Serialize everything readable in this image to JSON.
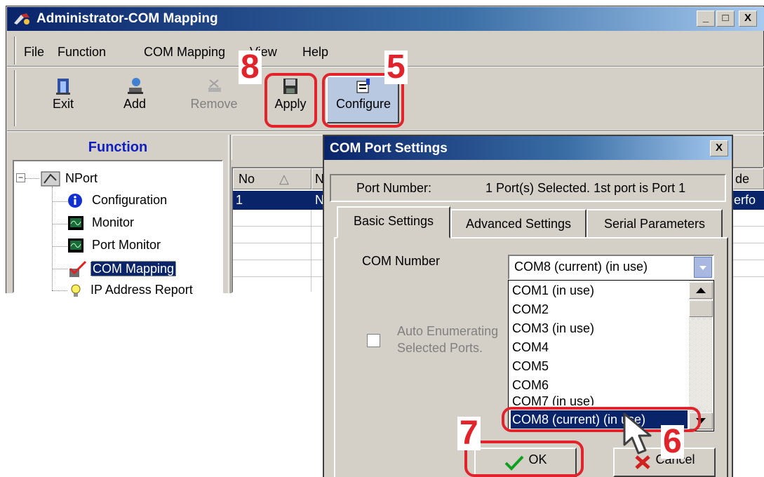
{
  "window": {
    "title": "Administrator-COM Mapping",
    "minimize": "_",
    "maximize": "□",
    "close": "X"
  },
  "menu": [
    "File",
    "Function",
    "COM Mapping",
    "View",
    "Help"
  ],
  "toolbar": {
    "exit": "Exit",
    "add": "Add",
    "remove": "Remove",
    "apply": "Apply",
    "configure": "Configure"
  },
  "function_header": "Function",
  "tree": {
    "root": "NPort",
    "expander": "−",
    "items": [
      "Configuration",
      "Monitor",
      "Port Monitor",
      "COM Mapping",
      "IP Address Report"
    ]
  },
  "table": {
    "col_no": "No",
    "sort_glyph": "△",
    "col_trunc": "N",
    "col_mode_trunc": "de",
    "row_no": "1",
    "row_trunc": "N",
    "row_mode_trunc": "erfo"
  },
  "dialog": {
    "title": "COM Port Settings",
    "close": "X",
    "port_number_label": "Port Number:",
    "port_number_value": "1 Port(s) Selected. 1st port is Port 1",
    "tabs": [
      "Basic Settings",
      "Advanced Settings",
      "Serial Parameters"
    ],
    "com_number_label": "COM Number",
    "com_selected": "COM8 (current) (in use)",
    "com_options": [
      "COM1 (in use)",
      "COM2",
      "COM3 (in use)",
      "COM4",
      "COM5",
      "COM6",
      "COM7 (in use)",
      "COM8 (current) (in use)"
    ],
    "auto_enum_label_1": "Auto Enumerating",
    "auto_enum_label_2": "Selected Ports.",
    "ok": "OK",
    "cancel": "Cancel"
  },
  "annotations": [
    "8",
    "5",
    "6",
    "7"
  ],
  "colors": {
    "annotation_red": "#e1232b",
    "title_blue": "#0a246a",
    "selection_blue": "#0a246a"
  }
}
